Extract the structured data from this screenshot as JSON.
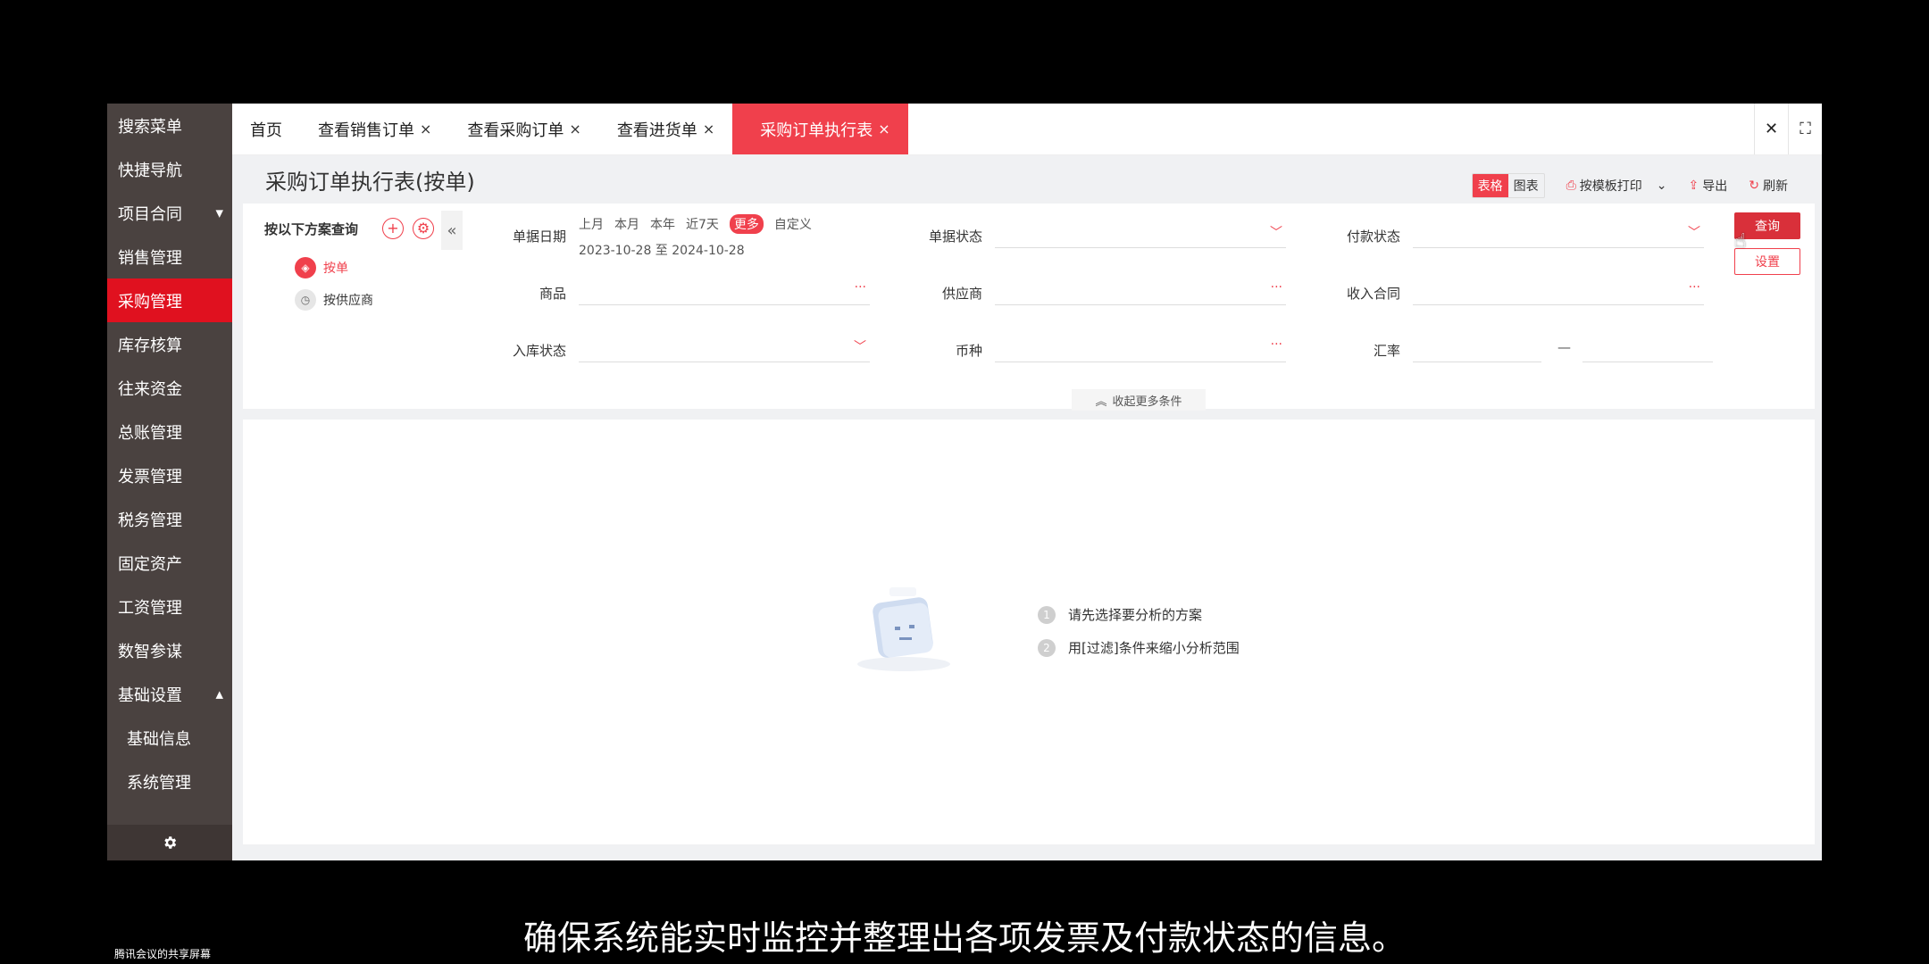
{
  "sidebar": {
    "items": [
      {
        "label": "搜索菜单"
      },
      {
        "label": "快捷导航"
      },
      {
        "label": "项目合同",
        "caret": "▼"
      },
      {
        "label": "销售管理"
      },
      {
        "label": "采购管理"
      },
      {
        "label": "库存核算"
      },
      {
        "label": "往来资金"
      },
      {
        "label": "总账管理"
      },
      {
        "label": "发票管理"
      },
      {
        "label": "税务管理"
      },
      {
        "label": "固定资产"
      },
      {
        "label": "工资管理"
      },
      {
        "label": "数智参谋"
      },
      {
        "label": "基础设置",
        "caret": "▲"
      },
      {
        "label": "基础信息"
      },
      {
        "label": "系统管理"
      }
    ],
    "footer_icon": "gear-icon"
  },
  "tabs": [
    {
      "label": "首页"
    },
    {
      "label": "查看销售订单",
      "close": "×"
    },
    {
      "label": "查看采购订单",
      "close": "×"
    },
    {
      "label": "查看进货单",
      "close": "×"
    },
    {
      "label": "采购订单执行表",
      "close": "×"
    }
  ],
  "tab_tools": {
    "close": "✕",
    "fullscreen": "⛶"
  },
  "page": {
    "title": "采购订单执行表(按单)",
    "view_table": "表格",
    "view_chart": "图表",
    "print": "按模板打印",
    "export": "导出",
    "refresh": "刷新"
  },
  "plan": {
    "heading": "按以下方案查询",
    "items": [
      {
        "label": "按单"
      },
      {
        "label": "按供应商"
      }
    ]
  },
  "filters": {
    "date_label": "单据日期",
    "date_quick": [
      "上月",
      "本月",
      "本年",
      "近7天",
      "更多",
      "自定义"
    ],
    "date_range": "2023-10-28 至 2024-10-28",
    "doc_status_label": "单据状态",
    "pay_status_label": "付款状态",
    "product_label": "商品",
    "supplier_label": "供应商",
    "income_contract_label": "收入合同",
    "stock_status_label": "入库状态",
    "currency_label": "币种",
    "rate_label": "汇率",
    "rate_sep": "—",
    "collapse_more": "收起更多条件"
  },
  "actions": {
    "query": "查询",
    "settings": "设置"
  },
  "empty": {
    "hint1_num": "1",
    "hint1": "请先选择要分析的方案",
    "hint2_num": "2",
    "hint2": "用[过滤]条件来缩小分析范围"
  },
  "caption": "确保系统能实时监控并整理出各项发票及付款状态的信息。",
  "corner_note": "腾讯会议的共享屏幕"
}
